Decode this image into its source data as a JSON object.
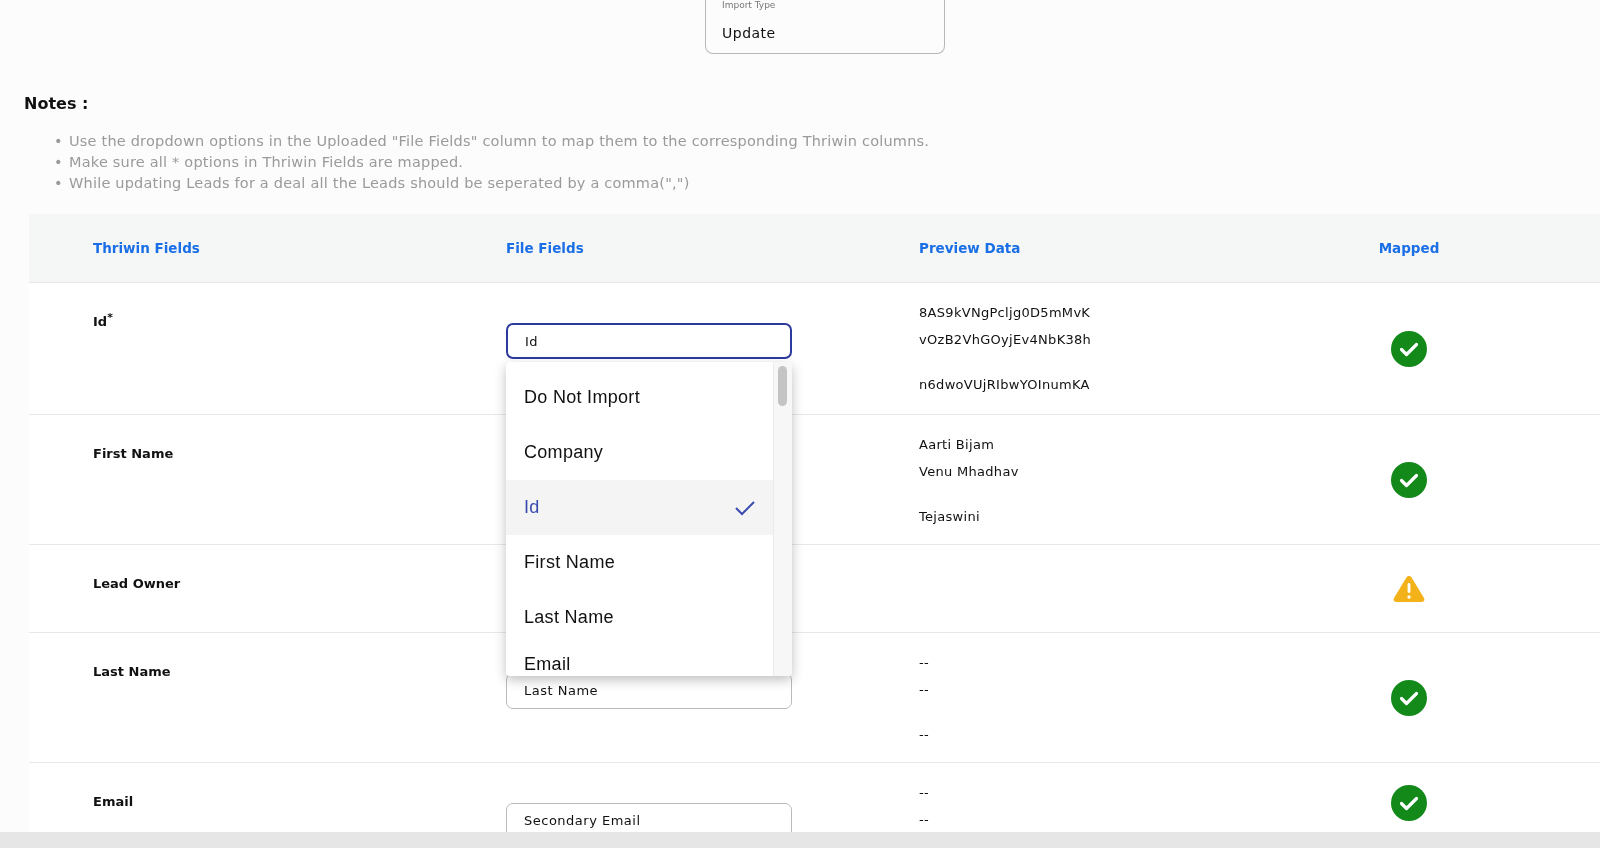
{
  "import_type": {
    "label": "Import Type",
    "value": "Update"
  },
  "notes": {
    "title": "Notes :",
    "bullet": "•",
    "items": [
      "Use the dropdown options in the Uploaded \"File Fields\" column to map them to the corresponding Thriwin columns.",
      "Make sure all * options in Thriwin Fields are mapped.",
      "While updating Leads for a deal all the Leads should be seperated by a comma(\",\")"
    ]
  },
  "table": {
    "columns": [
      "Thriwin Fields",
      "File Fields",
      "Preview Data",
      "Mapped"
    ],
    "rows": [
      {
        "thriwin_field": "Id$^{*}$",
        "file_field": "Id",
        "focused": true,
        "preview": [
          "8AS9kVNgPcljg0D5mMvK",
          "vOzB2VhGOyjEv4NbK38h",
          "n6dwoVUjRIbwYOInumKA"
        ],
        "mapped": true
      },
      {
        "thriwin_field": "First Name",
        "preview": [
          "Aarti Bijam",
          "Venu Mhadhav",
          "Tejaswini"
        ],
        "mapped": true
      },
      {
        "thriwin_field": "Lead Owner",
        "preview": [],
        "mapped": false
      },
      {
        "thriwin_field": "Last Name",
        "file_field": "Last Name",
        "focused": false,
        "preview": [
          "--",
          "--",
          "--"
        ],
        "mapped": true
      },
      {
        "thriwin_field": "Email",
        "file_field": "Secondary Email",
        "focused": false,
        "preview": [
          "--",
          "--"
        ],
        "mapped": true
      }
    ]
  },
  "dropdown": {
    "options": [
      {
        "label": "Do Not Import",
        "selected": false
      },
      {
        "label": "Company",
        "selected": false
      },
      {
        "label": "Id",
        "selected": true
      },
      {
        "label": "First Name",
        "selected": false
      },
      {
        "label": "Last Name",
        "selected": false
      },
      {
        "label": "Email",
        "selected": false
      }
    ]
  }
}
